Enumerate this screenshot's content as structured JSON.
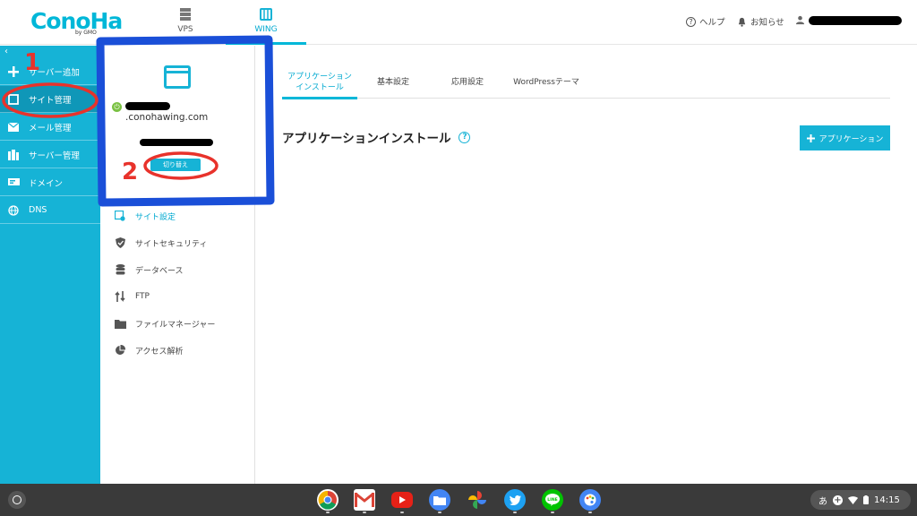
{
  "header": {
    "logo_text": "ConoHa",
    "logo_sub": "by GMO",
    "tabs": [
      {
        "label": "VPS",
        "icon": "server-icon"
      },
      {
        "label": "WING",
        "icon": "wing-icon",
        "active": true
      }
    ],
    "help_label": "ヘルプ",
    "notice_label": "お知らせ"
  },
  "sidebar": {
    "items": [
      {
        "label": "サーバー追加",
        "icon": "plus-icon"
      },
      {
        "label": "サイト管理",
        "icon": "site-icon",
        "active": true
      },
      {
        "label": "メール管理",
        "icon": "mail-icon"
      },
      {
        "label": "サーバー管理",
        "icon": "server-manage-icon"
      },
      {
        "label": "ドメイン",
        "icon": "domain-icon"
      },
      {
        "label": "DNS",
        "icon": "globe-icon"
      }
    ]
  },
  "site_card": {
    "domain": ".conohawing.com",
    "switch_label": "切り替え"
  },
  "site_menu": {
    "items": [
      {
        "label": "サイト設定",
        "icon": "site-settings-icon",
        "active": true
      },
      {
        "label": "サイトセキュリティ",
        "icon": "shield-icon"
      },
      {
        "label": "データベース",
        "icon": "database-icon"
      },
      {
        "label": "FTP",
        "icon": "transfer-icon"
      },
      {
        "label": "ファイルマネージャー",
        "icon": "folder-icon"
      },
      {
        "label": "アクセス解析",
        "icon": "pie-chart-icon"
      }
    ]
  },
  "main": {
    "tabs": [
      {
        "label_line1": "アプリケーション",
        "label_line2": "インストール",
        "active": true
      },
      {
        "label_line1": "基本設定",
        "label_line2": ""
      },
      {
        "label_line1": "応用設定",
        "label_line2": ""
      },
      {
        "label_line1": "WordPressテーマ",
        "label_line2": ""
      }
    ],
    "section_title": "アプリケーションインストール",
    "add_button_label": "アプリケーション"
  },
  "annotations": {
    "step1": "1",
    "step2": "2"
  },
  "shelf": {
    "apps": [
      "chrome-icon",
      "gmail-icon",
      "youtube-icon",
      "files-icon",
      "photos-icon",
      "twitter-icon",
      "line-icon",
      "paint-icon"
    ],
    "ime": "あ",
    "time": "14:15"
  },
  "colors": {
    "accent": "#16b3d6",
    "annotation_red": "#e8322b",
    "annotation_blue": "#1a4fd8"
  }
}
